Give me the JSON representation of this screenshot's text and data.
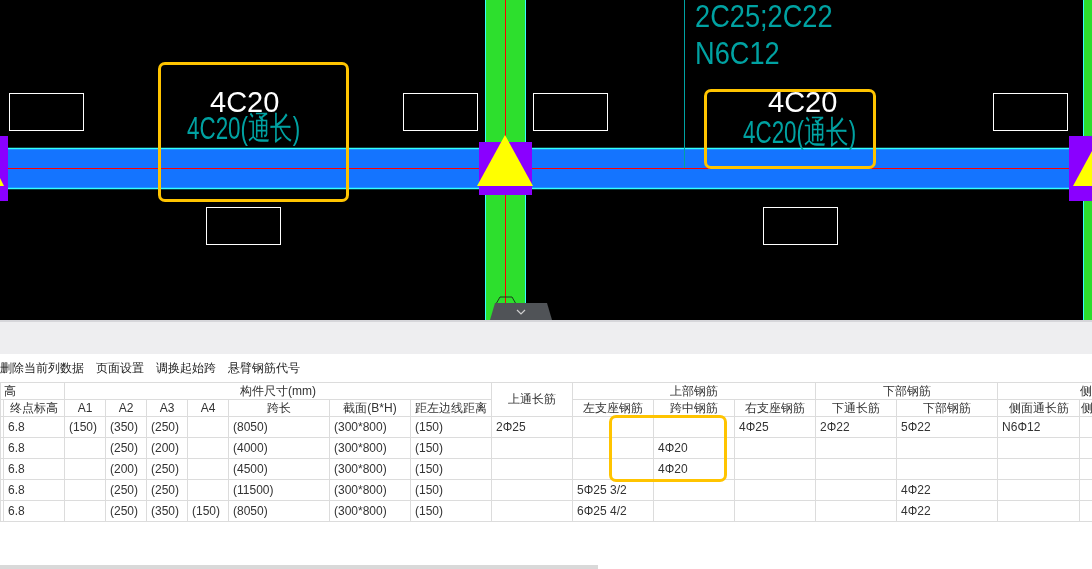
{
  "canvas": {
    "spans": [
      {
        "input_label": "4C20",
        "drawing_label": "4C20(通长)"
      },
      {
        "input_label": "4C20",
        "drawing_label": "4C20(通长)"
      }
    ],
    "leader_labels": [
      "2C25;2C22",
      "N6C12"
    ]
  },
  "toolbar": {
    "items": [
      "删除当前列数据",
      "页面设置",
      "调换起始跨",
      "悬臂钢筋代号"
    ]
  },
  "table": {
    "groups": [
      {
        "label": "高",
        "columns": [
          "终点标高"
        ]
      },
      {
        "label": "构件尺寸(mm)",
        "columns": [
          "A1",
          "A2",
          "A3",
          "A4",
          "跨长",
          "截面(B*H)",
          "距左边线距离"
        ]
      },
      {
        "label": "上通长筋"
      },
      {
        "label": "上部钢筋",
        "columns": [
          "左支座钢筋",
          "跨中钢筋",
          "右支座钢筋"
        ]
      },
      {
        "label": "下部钢筋",
        "columns": [
          "下通长筋",
          "下部钢筋"
        ]
      },
      {
        "label": "侧",
        "columns": [
          "侧面通长筋",
          "侧"
        ]
      }
    ],
    "rows": [
      [
        "6.8",
        "(150)",
        "(350)",
        "(250)",
        null,
        "(8050)",
        "(300*800)",
        "(150)",
        "2Φ25",
        null,
        null,
        "4Φ25",
        "2Φ22",
        "5Φ22",
        "N6Φ12",
        null
      ],
      [
        "6.8",
        null,
        "(250)",
        "(200)",
        null,
        "(4000)",
        "(300*800)",
        "(150)",
        null,
        null,
        "4Φ20",
        null,
        null,
        null,
        null,
        null
      ],
      [
        "6.8",
        null,
        "(200)",
        "(250)",
        null,
        "(4500)",
        "(300*800)",
        "(150)",
        null,
        null,
        "4Φ20",
        null,
        null,
        null,
        null,
        null
      ],
      [
        "6.8",
        null,
        "(250)",
        "(250)",
        null,
        "(11500)",
        "(300*800)",
        "(150)",
        null,
        "5Φ25 3/2",
        null,
        null,
        null,
        "4Φ22",
        null,
        null
      ],
      [
        "6.8",
        null,
        "(250)",
        "(350)",
        "(150)",
        "(8050)",
        "(300*800)",
        "(150)",
        null,
        "6Φ25 4/2",
        null,
        null,
        null,
        "4Φ22",
        null,
        null
      ]
    ]
  }
}
